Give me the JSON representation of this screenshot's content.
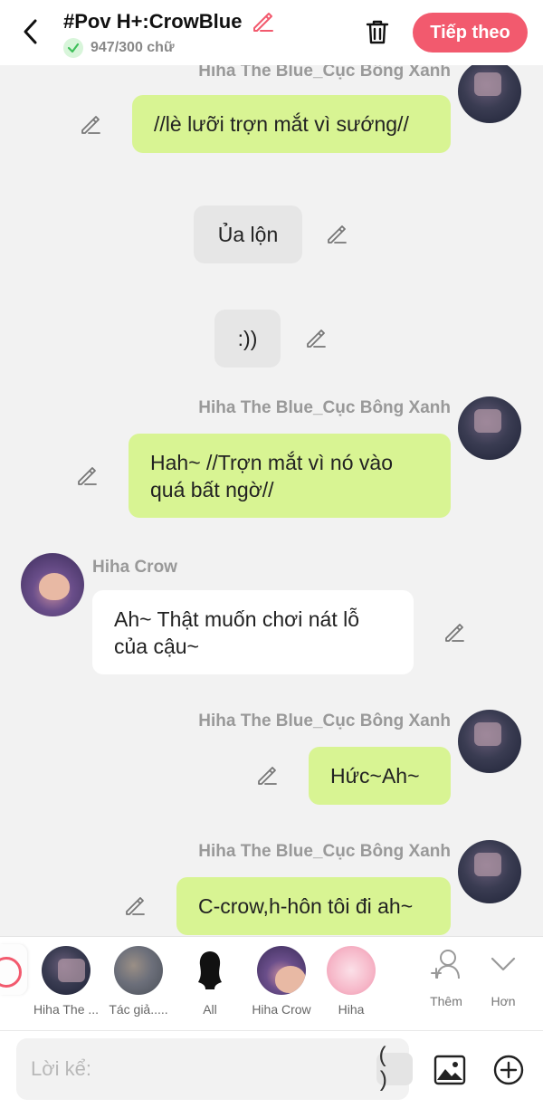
{
  "header": {
    "title": "#Pov H+:CrowBlue",
    "word_count": "947/300 chữ",
    "next_label": "Tiếp theo"
  },
  "messages": [
    {
      "speaker": "Hiha The Blue_Cục Bông Xanh",
      "text": "//lè lưỡi trợn mắt vì sướng//",
      "side": "right"
    },
    {
      "speaker": "",
      "text": "Ủa lộn",
      "side": "narration"
    },
    {
      "speaker": "",
      "text": ":))",
      "side": "narration"
    },
    {
      "speaker": "Hiha The Blue_Cục Bông Xanh",
      "text": "Hah~ //Trợn mắt vì nó vào quá bất ngờ//",
      "side": "right"
    },
    {
      "speaker": "Hiha Crow",
      "text": "Ah~ Thật muốn chơi nát lỗ của cậu~",
      "side": "left"
    },
    {
      "speaker": "Hiha The Blue_Cục Bông Xanh",
      "text": "Hức~Ah~",
      "side": "right"
    },
    {
      "speaker": "Hiha The Blue_Cục Bông Xanh",
      "text": "C-crow,h-hôn tôi đi ah~",
      "side": "right"
    }
  ],
  "characters": [
    {
      "label": "Hiha The ..."
    },
    {
      "label": "Tác giả....."
    },
    {
      "label": "All"
    },
    {
      "label": "Hiha Crow"
    },
    {
      "label": "Hiha"
    }
  ],
  "tools": {
    "add_label": "Thêm",
    "more_label": "Hơn"
  },
  "composer": {
    "placeholder": "Lời kể:",
    "paren_label": "( )"
  },
  "colors": {
    "accent": "#f25a6e",
    "bubble_green": "#d8f493",
    "bubble_gray": "#e6e6e6",
    "background": "#f2f2f2"
  }
}
